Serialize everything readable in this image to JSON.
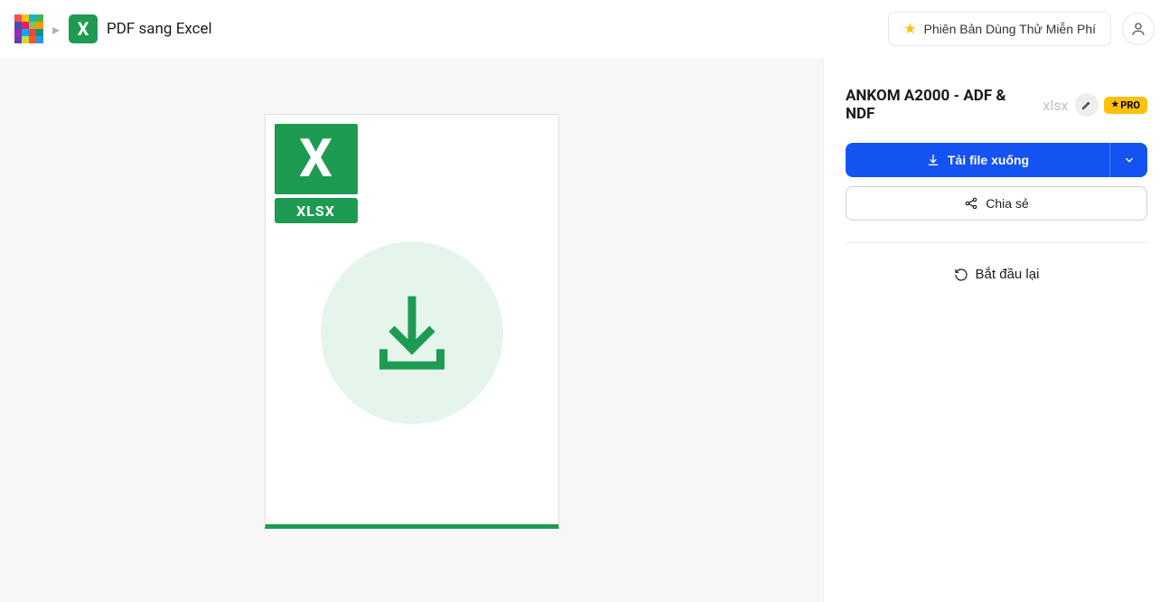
{
  "header": {
    "title": "PDF sang Excel",
    "trial_label": "Phiên Bản Dùng Thử Miễn Phí",
    "excel_letter": "X"
  },
  "preview": {
    "logo_letter": "X",
    "format_tag": "XLSX"
  },
  "sidebar": {
    "file_name": "ANKOM A2000 - ADF & NDF",
    "file_ext": "xlsx",
    "pro_label": "PRO",
    "download_label": "Tải file xuống",
    "share_label": "Chia sẻ",
    "restart_label": "Bắt đầu lại"
  }
}
